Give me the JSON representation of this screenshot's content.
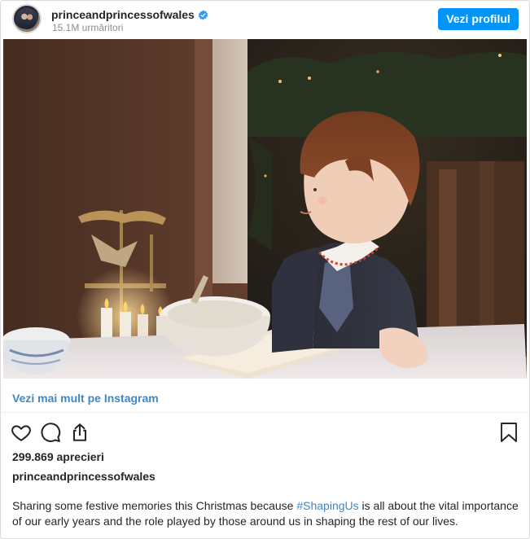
{
  "header": {
    "username": "princeandprincessofwales",
    "followers": "15.1M urmăritori",
    "view_profile_label": "Vezi profilul"
  },
  "post": {
    "more_link": "Vezi mai mult pe Instagram",
    "likes": "299.869 aprecieri",
    "author": "princeandprincessofwales",
    "caption_before": "Sharing some festive memories this Christmas because ",
    "caption_hashtag": "#ShapingUs",
    "caption_after": " is all about the vital importance of our early years and the role played by those around us in shaping the rest of our lives."
  },
  "icons": {
    "verified": "verified-badge-icon",
    "like": "heart-icon",
    "comment": "comment-icon",
    "share": "share-icon",
    "save": "bookmark-icon"
  },
  "colors": {
    "accent": "#0095f6",
    "link": "#3f87c6",
    "text": "#262626",
    "muted": "#8e8e8e"
  }
}
